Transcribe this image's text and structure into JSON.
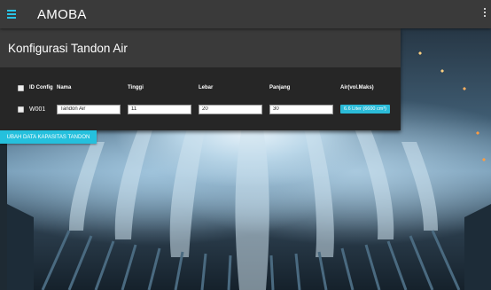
{
  "app": {
    "title": "AMOBA"
  },
  "card": {
    "title": "Konfigurasi Tandon Air"
  },
  "table": {
    "headers": [
      "ID Config",
      "Nama",
      "Tinggi",
      "Lebar",
      "Panjang",
      "Air(vol.Maks)"
    ],
    "rows": [
      {
        "id": "W001",
        "nama": "Tandon Air",
        "tinggi": "11",
        "lebar": "20",
        "panjang": "30",
        "volume": "6.6 Liter (6600 cm³)"
      }
    ]
  },
  "actions": {
    "update_label": "UBAH DATA KAPASITAS TANDON"
  },
  "colors": {
    "accent": "#29c4e6",
    "appbar": "#3a3a3a",
    "card": "#262626"
  }
}
